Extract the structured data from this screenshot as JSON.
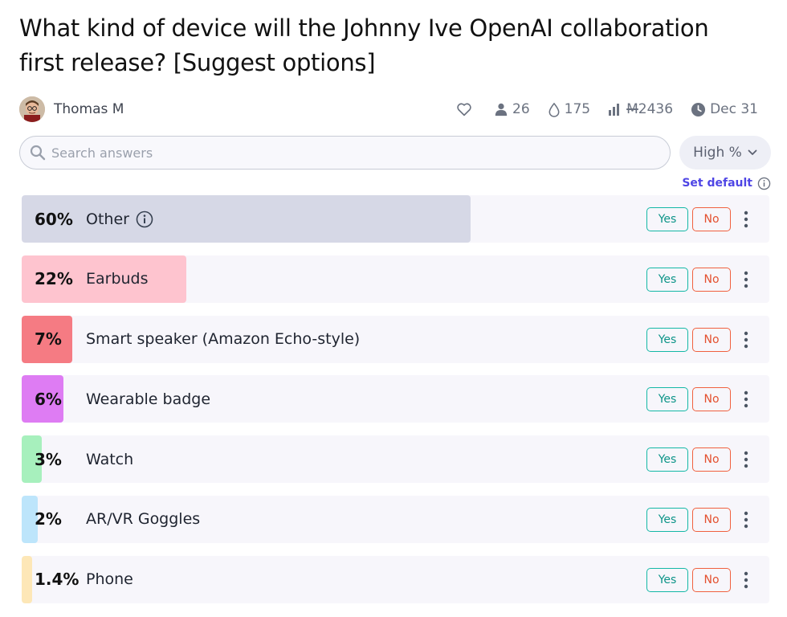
{
  "question": {
    "title": "What kind of device will the Johnny Ive OpenAI collaboration first release? [Suggest options]"
  },
  "author": {
    "name": "Thomas M",
    "avatar_icon": "user-avatar"
  },
  "stats": {
    "traders": "26",
    "likes_icon": "heart-icon",
    "liquidity": "175",
    "volume": "2436",
    "volume_currency": "M",
    "close_date": "Dec 31"
  },
  "search": {
    "placeholder": "Search answers",
    "value": ""
  },
  "sort": {
    "label": "High %"
  },
  "set_default": {
    "label": "Set default"
  },
  "actions": {
    "yes_label": "Yes",
    "no_label": "No"
  },
  "colors": {
    "yes": "#14b8a6",
    "no": "#f0613f",
    "accent": "#4f46e5"
  },
  "answers": [
    {
      "pct_label": "60%",
      "prob": 0.6,
      "text": "Other",
      "color": "#d6d8e6",
      "info": true
    },
    {
      "pct_label": "22%",
      "prob": 0.22,
      "text": "Earbuds",
      "color": "#fec4cf",
      "info": false
    },
    {
      "pct_label": "7%",
      "prob": 0.068,
      "text": "Smart speaker (Amazon Echo-style)",
      "color": "#f57b83",
      "info": false
    },
    {
      "pct_label": "6%",
      "prob": 0.056,
      "text": "Wearable badge",
      "color": "#de7cf3",
      "info": false
    },
    {
      "pct_label": "3%",
      "prob": 0.027,
      "text": "Watch",
      "color": "#a7f0bd",
      "info": false
    },
    {
      "pct_label": "2%",
      "prob": 0.021,
      "text": "AR/VR Goggles",
      "color": "#bde5fb",
      "info": false
    },
    {
      "pct_label": "1.4%",
      "prob": 0.014,
      "text": "Phone",
      "color": "#fde7b7",
      "info": false
    }
  ]
}
